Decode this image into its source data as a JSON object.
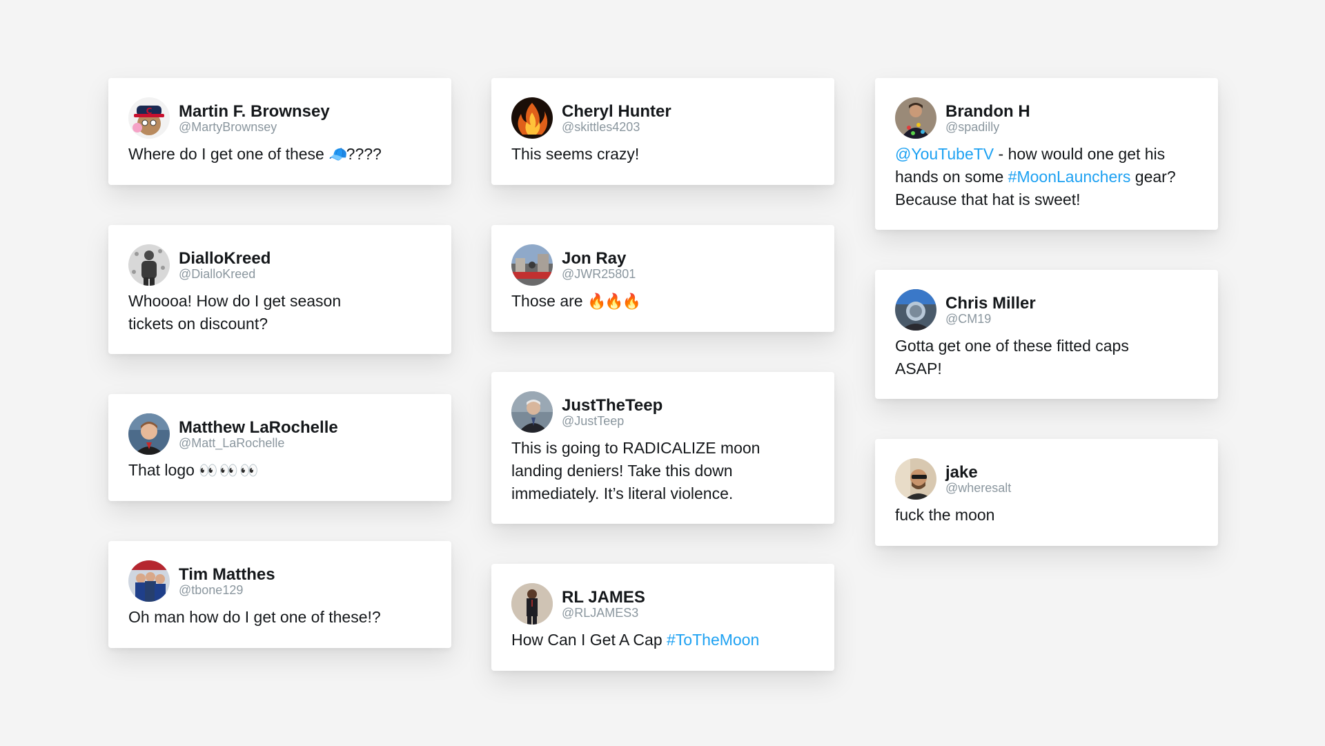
{
  "tweets": {
    "martin": {
      "name": "Martin F. Brownsey",
      "handle": "@MartyBrownsey",
      "text_before": "Where do I get one of these",
      "emoji": "🧢",
      "text_after": "????"
    },
    "diallo": {
      "name": "DialloKreed",
      "handle": "@DialloKreed",
      "text": "Whoooa! How do I get season tickets on discount?"
    },
    "matthew": {
      "name": "Matthew LaRochelle",
      "handle": "@Matt_LaRochelle",
      "text": "That logo",
      "emoji": "👀 👀 👀"
    },
    "tim": {
      "name": "Tim Matthes",
      "handle": "@tbone129",
      "text": "Oh man how do I get one of these!?"
    },
    "cheryl": {
      "name": "Cheryl Hunter",
      "handle": "@skittles4203",
      "text": "This seems crazy!"
    },
    "jon": {
      "name": "Jon Ray",
      "handle": "@JWR25801",
      "text": "Those are",
      "emoji": "🔥🔥🔥"
    },
    "teep": {
      "name": "JustTheTeep",
      "handle": "@JustTeep",
      "text": "This is going to RADICALIZE moon landing deniers! Take this down immediately. It’s literal violence."
    },
    "rl": {
      "name": "RL JAMES",
      "handle": "@RLJAMES3",
      "text": "How Can I Get A Cap",
      "hashtag": "#ToTheMoon"
    },
    "brandon": {
      "name": "Brandon H",
      "handle": "@spadilly",
      "mention": "@YouTubeTV",
      "text_1": " - how would one get his hands on some ",
      "hashtag": "#MoonLaunchers",
      "text_2": " gear? Because that hat is sweet!"
    },
    "chris": {
      "name": "Chris Miller",
      "handle": "@CM19",
      "text": "Gotta get one of these fitted caps ASAP!"
    },
    "jake": {
      "name": "jake",
      "handle": "@wheresalt",
      "text": "fuck the moon"
    }
  },
  "colors": {
    "background": "#f4f4f4",
    "card": "#ffffff",
    "link": "#1da1f2",
    "handle": "#8a969e",
    "text": "#14171a"
  }
}
